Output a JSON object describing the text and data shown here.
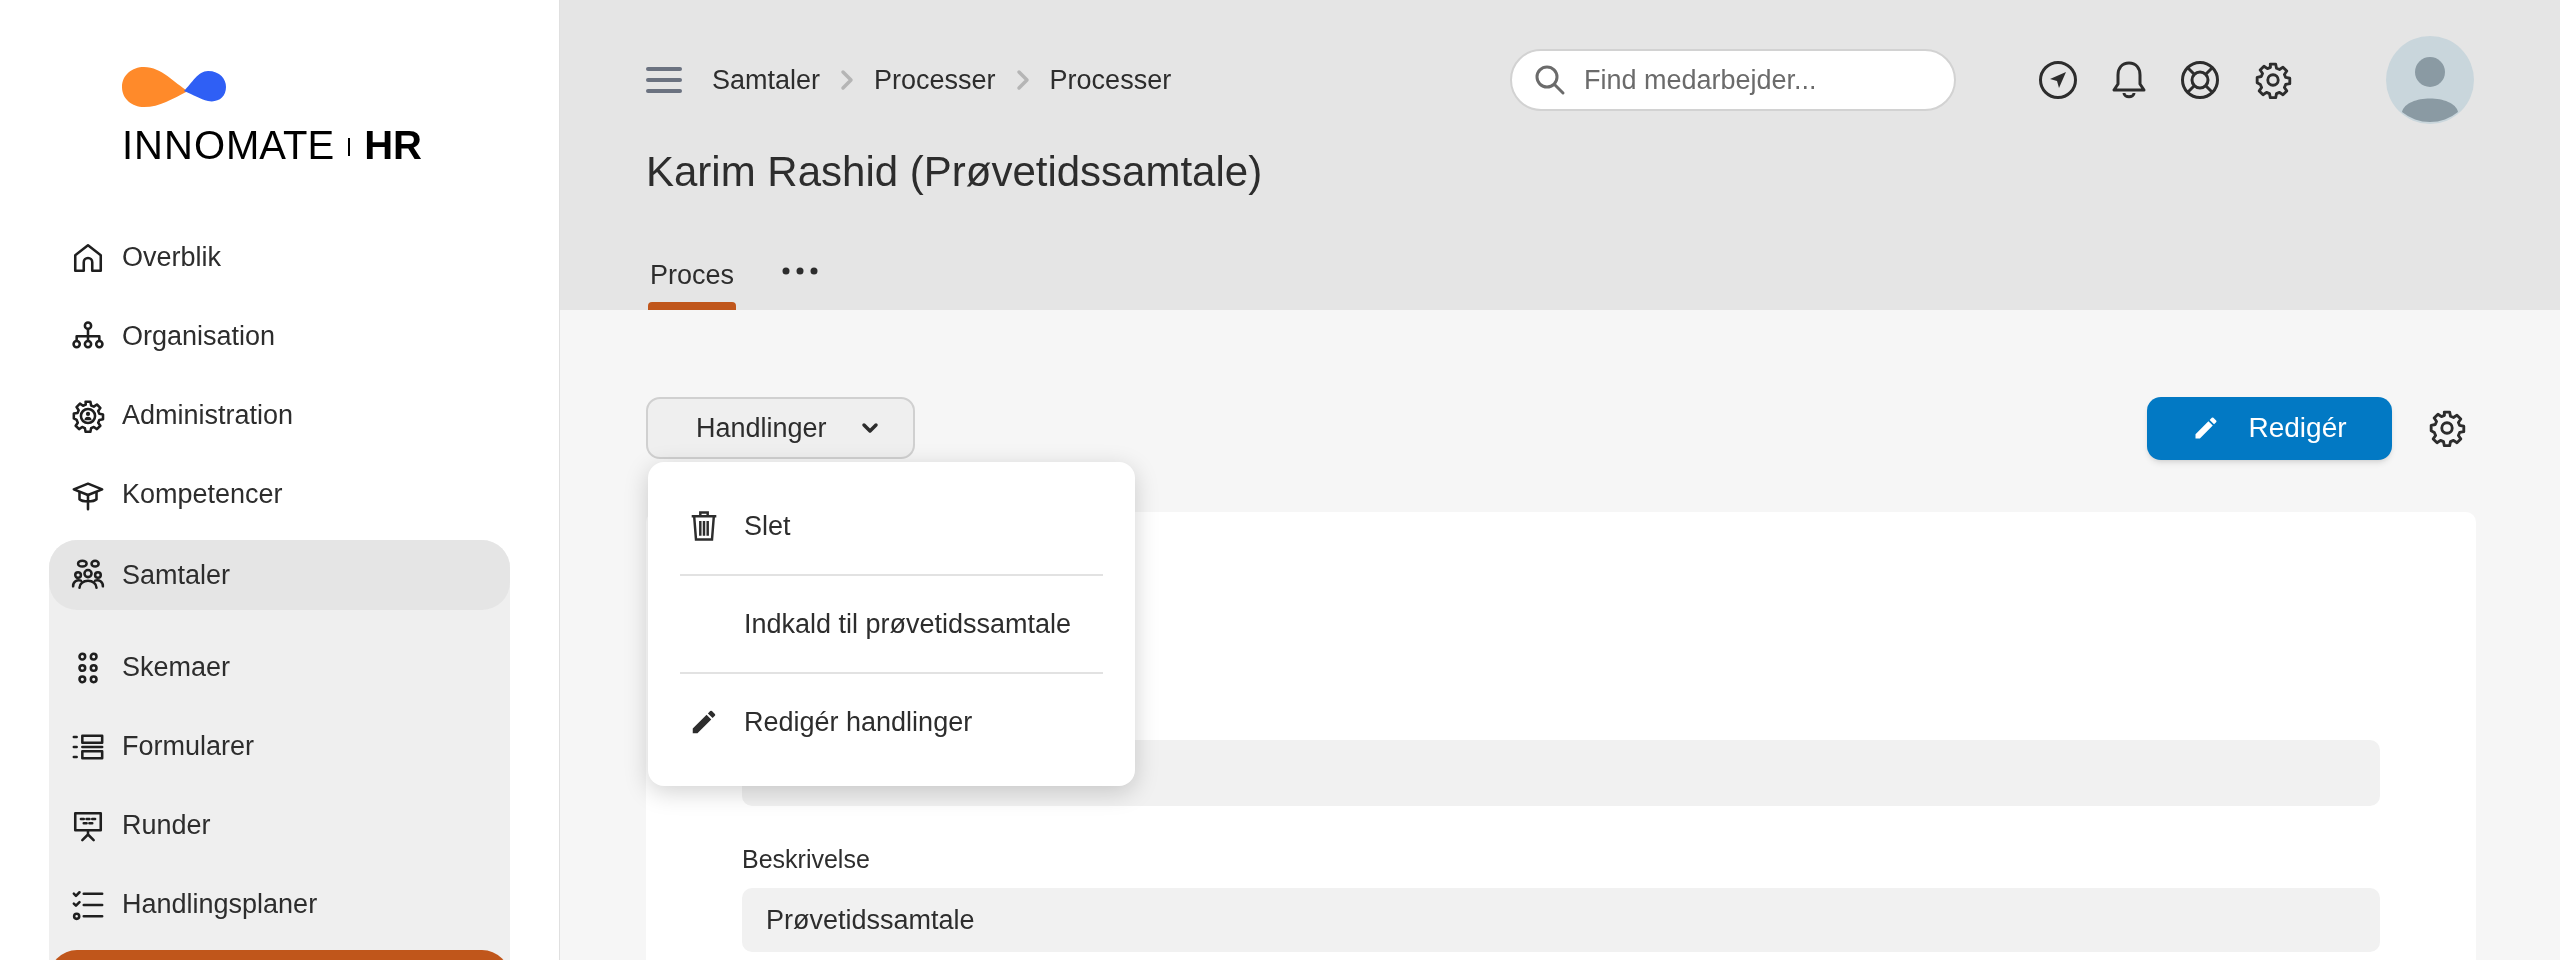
{
  "logo": {
    "parts": [
      {
        "text": "INNO",
        "kind": "light"
      },
      {
        "text": "MATE",
        "kind": "regular"
      },
      {
        "text": "HR",
        "kind": "bold"
      }
    ]
  },
  "sidebar": {
    "items": [
      {
        "label": "Overblik",
        "selected": false,
        "expanded": false
      },
      {
        "label": "Organisation",
        "selected": false,
        "expanded": false
      },
      {
        "label": "Administration",
        "selected": false,
        "expanded": false
      },
      {
        "label": "Kompetencer",
        "selected": false,
        "expanded": false
      },
      {
        "label": "Samtaler",
        "selected": true,
        "expanded": true,
        "children": [
          {
            "label": "Skemaer"
          },
          {
            "label": "Formularer"
          },
          {
            "label": "Runder"
          },
          {
            "label": "Handlingsplaner"
          }
        ]
      }
    ]
  },
  "header": {
    "breadcrumbs": [
      "Samtaler",
      "Processer",
      "Processer"
    ],
    "search": {
      "placeholder": "Find medarbejder..."
    },
    "title": "Karim Rashid (Prøvetidssamtale)",
    "tabs": [
      {
        "label": "Proces",
        "selected": true
      }
    ]
  },
  "toolbar": {
    "actions_button": "Handlinger",
    "edit_button": "Redigér"
  },
  "actions_menu": {
    "items": [
      {
        "label": "Slet",
        "kind": "delete"
      },
      {
        "label": "Indkald til prøvetidssamtale",
        "kind": "plain"
      },
      {
        "label": "Redigér handlinger",
        "kind": "edit"
      }
    ]
  },
  "form": {
    "fields": [
      {
        "label": "Beskrivelse",
        "value": "Prøvetidssamtale"
      }
    ]
  }
}
